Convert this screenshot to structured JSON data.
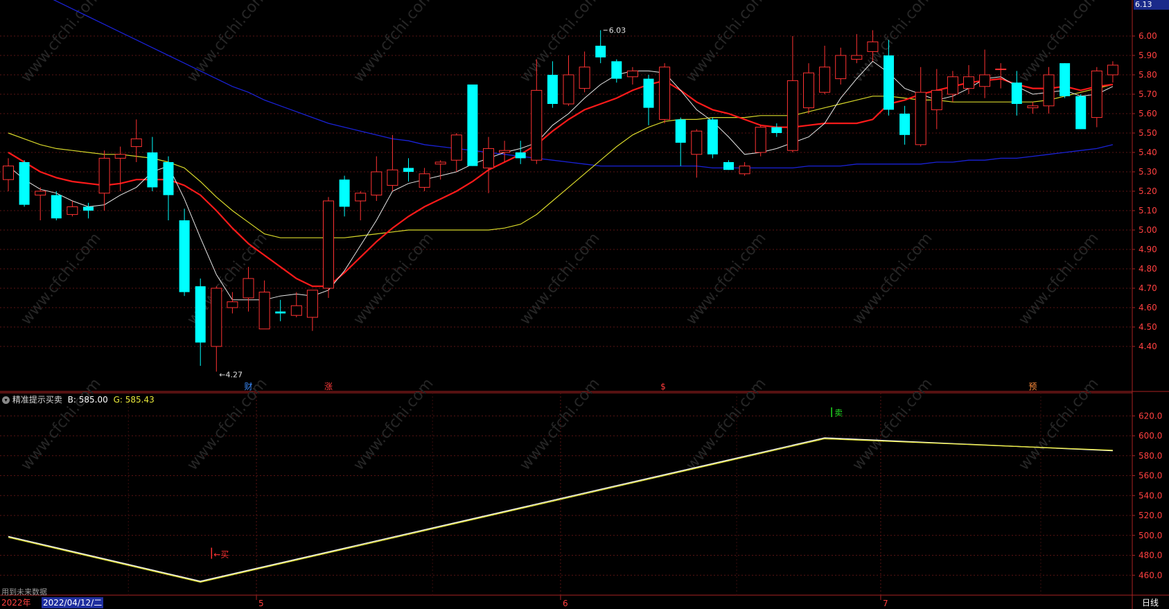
{
  "top_right_price": "6.13",
  "right_panel_label": "日线",
  "main": {
    "yticks": [
      "6.00",
      "5.90",
      "5.80",
      "5.70",
      "5.60",
      "5.50",
      "5.40",
      "5.30",
      "5.20",
      "5.10",
      "5.00",
      "4.90",
      "4.80",
      "4.70",
      "4.60",
      "4.50",
      "4.40"
    ],
    "high_label": "6.03",
    "low_label": "4.27",
    "markers": [
      {
        "text": "财",
        "color": "#3b8cff",
        "index": 15
      },
      {
        "text": "涨",
        "color": "#ff3b3b",
        "index": 20
      },
      {
        "text": "$",
        "color": "#ff3b3b",
        "index": 41
      },
      {
        "text": "预",
        "color": "#ff8c3b",
        "index": 64
      }
    ]
  },
  "indicator": {
    "name": "精准提示买卖",
    "b_text": "B: 585.00",
    "g_text": "G: 585.43",
    "yticks": [
      "620.0",
      "600.0",
      "580.0",
      "560.0",
      "540.0",
      "520.0",
      "500.0",
      "480.0",
      "460.0"
    ],
    "buy_label": "←买",
    "sell_label": "卖",
    "note": "用到未来数据"
  },
  "xaxis": {
    "year": "2022年",
    "cursor_date": "2022/04/12/二",
    "months": [
      {
        "label": "5",
        "index": 16
      },
      {
        "label": "6",
        "index": 35
      },
      {
        "label": "7",
        "index": 55
      }
    ]
  },
  "chart_data": [
    {
      "type": "candlestick",
      "ylim": [
        4.27,
        6.13
      ],
      "candles": [
        {
          "o": 5.26,
          "h": 5.37,
          "l": 5.2,
          "c": 5.33
        },
        {
          "o": 5.35,
          "h": 5.36,
          "l": 5.12,
          "c": 5.13
        },
        {
          "o": 5.18,
          "h": 5.22,
          "l": 5.05,
          "c": 5.2
        },
        {
          "o": 5.18,
          "h": 5.2,
          "l": 5.05,
          "c": 5.06
        },
        {
          "o": 5.08,
          "h": 5.15,
          "l": 5.07,
          "c": 5.12
        },
        {
          "o": 5.12,
          "h": 5.14,
          "l": 5.06,
          "c": 5.1
        },
        {
          "o": 5.19,
          "h": 5.41,
          "l": 5.1,
          "c": 5.37
        },
        {
          "o": 5.37,
          "h": 5.43,
          "l": 5.2,
          "c": 5.39
        },
        {
          "o": 5.43,
          "h": 5.57,
          "l": 5.35,
          "c": 5.47
        },
        {
          "o": 5.4,
          "h": 5.48,
          "l": 5.2,
          "c": 5.22
        },
        {
          "o": 5.35,
          "h": 5.38,
          "l": 5.05,
          "c": 5.18
        },
        {
          "o": 5.05,
          "h": 5.11,
          "l": 4.66,
          "c": 4.68
        },
        {
          "o": 4.71,
          "h": 4.75,
          "l": 4.3,
          "c": 4.42
        },
        {
          "o": 4.4,
          "h": 4.71,
          "l": 4.27,
          "c": 4.7
        },
        {
          "o": 4.6,
          "h": 4.68,
          "l": 4.57,
          "c": 4.63
        },
        {
          "o": 4.65,
          "h": 4.81,
          "l": 4.58,
          "c": 4.75
        },
        {
          "o": 4.49,
          "h": 4.74,
          "l": 4.49,
          "c": 4.68
        },
        {
          "o": 4.58,
          "h": 4.64,
          "l": 4.53,
          "c": 4.57
        },
        {
          "o": 4.56,
          "h": 4.68,
          "l": 4.55,
          "c": 4.61
        },
        {
          "o": 4.55,
          "h": 4.69,
          "l": 4.48,
          "c": 4.69
        },
        {
          "o": 4.7,
          "h": 5.17,
          "l": 4.65,
          "c": 5.15
        },
        {
          "o": 5.26,
          "h": 5.28,
          "l": 5.07,
          "c": 5.12
        },
        {
          "o": 5.15,
          "h": 5.2,
          "l": 5.05,
          "c": 5.19
        },
        {
          "o": 5.18,
          "h": 5.38,
          "l": 5.15,
          "c": 5.3
        },
        {
          "o": 5.23,
          "h": 5.49,
          "l": 5.2,
          "c": 5.31
        },
        {
          "o": 5.32,
          "h": 5.37,
          "l": 5.25,
          "c": 5.3
        },
        {
          "o": 5.22,
          "h": 5.32,
          "l": 5.2,
          "c": 5.29
        },
        {
          "o": 5.34,
          "h": 5.36,
          "l": 5.26,
          "c": 5.35
        },
        {
          "o": 5.36,
          "h": 5.5,
          "l": 5.3,
          "c": 5.49
        },
        {
          "o": 5.75,
          "h": 5.75,
          "l": 5.33,
          "c": 5.33
        },
        {
          "o": 5.32,
          "h": 5.48,
          "l": 5.19,
          "c": 5.42
        },
        {
          "o": 5.4,
          "h": 5.46,
          "l": 5.35,
          "c": 5.41
        },
        {
          "o": 5.4,
          "h": 5.46,
          "l": 5.34,
          "c": 5.37
        },
        {
          "o": 5.36,
          "h": 5.88,
          "l": 5.34,
          "c": 5.72
        },
        {
          "o": 5.8,
          "h": 5.87,
          "l": 5.63,
          "c": 5.65
        },
        {
          "o": 5.65,
          "h": 5.9,
          "l": 5.64,
          "c": 5.8
        },
        {
          "o": 5.73,
          "h": 5.92,
          "l": 5.71,
          "c": 5.84
        },
        {
          "o": 5.95,
          "h": 6.03,
          "l": 5.86,
          "c": 5.89
        },
        {
          "o": 5.87,
          "h": 5.88,
          "l": 5.76,
          "c": 5.78
        },
        {
          "o": 5.79,
          "h": 5.84,
          "l": 5.75,
          "c": 5.82
        },
        {
          "o": 5.78,
          "h": 5.8,
          "l": 5.54,
          "c": 5.63
        },
        {
          "o": 5.57,
          "h": 5.86,
          "l": 5.55,
          "c": 5.84
        },
        {
          "o": 5.57,
          "h": 5.58,
          "l": 5.33,
          "c": 5.45
        },
        {
          "o": 5.39,
          "h": 5.52,
          "l": 5.27,
          "c": 5.51
        },
        {
          "o": 5.57,
          "h": 5.58,
          "l": 5.37,
          "c": 5.39
        },
        {
          "o": 5.35,
          "h": 5.36,
          "l": 5.31,
          "c": 5.31
        },
        {
          "o": 5.29,
          "h": 5.35,
          "l": 5.28,
          "c": 5.33
        },
        {
          "o": 5.4,
          "h": 5.54,
          "l": 5.38,
          "c": 5.53
        },
        {
          "o": 5.53,
          "h": 5.55,
          "l": 5.48,
          "c": 5.5
        },
        {
          "o": 5.41,
          "h": 6.0,
          "l": 5.4,
          "c": 5.77
        },
        {
          "o": 5.63,
          "h": 5.86,
          "l": 5.6,
          "c": 5.81
        },
        {
          "o": 5.71,
          "h": 5.95,
          "l": 5.7,
          "c": 5.84
        },
        {
          "o": 5.78,
          "h": 5.94,
          "l": 5.75,
          "c": 5.9
        },
        {
          "o": 5.88,
          "h": 6.01,
          "l": 5.86,
          "c": 5.9
        },
        {
          "o": 5.92,
          "h": 6.03,
          "l": 5.87,
          "c": 5.97
        },
        {
          "o": 5.9,
          "h": 5.98,
          "l": 5.59,
          "c": 5.62
        },
        {
          "o": 5.6,
          "h": 5.64,
          "l": 5.44,
          "c": 5.49
        },
        {
          "o": 5.44,
          "h": 5.84,
          "l": 5.43,
          "c": 5.71
        },
        {
          "o": 5.62,
          "h": 5.83,
          "l": 5.52,
          "c": 5.72
        },
        {
          "o": 5.7,
          "h": 5.82,
          "l": 5.66,
          "c": 5.79
        },
        {
          "o": 5.73,
          "h": 5.85,
          "l": 5.7,
          "c": 5.79
        },
        {
          "o": 5.74,
          "h": 5.93,
          "l": 5.68,
          "c": 5.8
        },
        {
          "o": 5.83,
          "h": 5.86,
          "l": 5.73,
          "c": 5.83
        },
        {
          "o": 5.76,
          "h": 5.82,
          "l": 5.59,
          "c": 5.65
        },
        {
          "o": 5.63,
          "h": 5.66,
          "l": 5.6,
          "c": 5.64
        },
        {
          "o": 5.64,
          "h": 5.84,
          "l": 5.6,
          "c": 5.8
        },
        {
          "o": 5.86,
          "h": 5.86,
          "l": 5.68,
          "c": 5.69
        },
        {
          "o": 5.69,
          "h": 5.7,
          "l": 5.52,
          "c": 5.52
        },
        {
          "o": 5.58,
          "h": 5.84,
          "l": 5.53,
          "c": 5.82
        },
        {
          "o": 5.8,
          "h": 5.87,
          "l": 5.76,
          "c": 5.85
        }
      ],
      "ma_white": [
        5.33,
        5.26,
        5.21,
        5.19,
        5.15,
        5.12,
        5.13,
        5.18,
        5.22,
        5.3,
        5.33,
        5.16,
        4.96,
        4.77,
        4.64,
        4.64,
        4.64,
        4.66,
        4.67,
        4.66,
        4.69,
        4.79,
        4.92,
        5.05,
        5.2,
        5.24,
        5.26,
        5.28,
        5.3,
        5.34,
        5.37,
        5.4,
        5.42,
        5.45,
        5.54,
        5.6,
        5.68,
        5.75,
        5.8,
        5.82,
        5.82,
        5.81,
        5.72,
        5.62,
        5.56,
        5.48,
        5.39,
        5.4,
        5.42,
        5.45,
        5.48,
        5.55,
        5.68,
        5.78,
        5.87,
        5.81,
        5.73,
        5.7,
        5.67,
        5.69,
        5.73,
        5.78,
        5.79,
        5.74,
        5.7,
        5.71,
        5.72,
        5.69,
        5.7,
        5.74
      ],
      "ma_red": [
        5.4,
        5.35,
        5.3,
        5.27,
        5.25,
        5.24,
        5.23,
        5.24,
        5.26,
        5.26,
        5.26,
        5.23,
        5.18,
        5.1,
        5.01,
        4.93,
        4.87,
        4.81,
        4.75,
        4.71,
        4.71,
        4.78,
        4.86,
        4.94,
        5.01,
        5.07,
        5.12,
        5.16,
        5.2,
        5.25,
        5.31,
        5.35,
        5.39,
        5.44,
        5.51,
        5.57,
        5.62,
        5.65,
        5.68,
        5.72,
        5.75,
        5.77,
        5.72,
        5.66,
        5.62,
        5.6,
        5.57,
        5.54,
        5.53,
        5.53,
        5.54,
        5.55,
        5.55,
        5.55,
        5.57,
        5.65,
        5.67,
        5.7,
        5.72,
        5.74,
        5.76,
        5.77,
        5.78,
        5.75,
        5.73,
        5.73,
        5.74,
        5.72,
        5.74,
        5.75
      ],
      "ma_yellow": [
        5.5,
        5.47,
        5.44,
        5.42,
        5.41,
        5.4,
        5.39,
        5.39,
        5.38,
        5.37,
        5.35,
        5.32,
        5.25,
        5.17,
        5.1,
        5.04,
        4.98,
        4.96,
        4.96,
        4.96,
        4.96,
        4.96,
        4.97,
        4.98,
        4.99,
        5.0,
        5.0,
        5.0,
        5.0,
        5.0,
        5.0,
        5.01,
        5.03,
        5.08,
        5.15,
        5.22,
        5.29,
        5.36,
        5.43,
        5.49,
        5.53,
        5.56,
        5.57,
        5.57,
        5.58,
        5.58,
        5.58,
        5.59,
        5.59,
        5.59,
        5.61,
        5.63,
        5.65,
        5.67,
        5.69,
        5.69,
        5.68,
        5.67,
        5.67,
        5.66,
        5.66,
        5.66,
        5.66,
        5.66,
        5.66,
        5.67,
        5.69,
        5.71,
        5.73,
        5.75
      ],
      "ma_blue": [
        6.31,
        6.26,
        6.22,
        6.18,
        6.14,
        6.1,
        6.06,
        6.02,
        5.98,
        5.94,
        5.9,
        5.86,
        5.82,
        5.78,
        5.74,
        5.71,
        5.67,
        5.64,
        5.61,
        5.58,
        5.55,
        5.53,
        5.51,
        5.49,
        5.47,
        5.46,
        5.44,
        5.43,
        5.42,
        5.41,
        5.4,
        5.39,
        5.38,
        5.37,
        5.36,
        5.35,
        5.34,
        5.33,
        5.33,
        5.33,
        5.33,
        5.33,
        5.33,
        5.33,
        5.32,
        5.32,
        5.32,
        5.32,
        5.32,
        5.32,
        5.33,
        5.33,
        5.33,
        5.34,
        5.34,
        5.34,
        5.34,
        5.34,
        5.35,
        5.35,
        5.36,
        5.36,
        5.37,
        5.37,
        5.38,
        5.39,
        5.4,
        5.41,
        5.42,
        5.44
      ]
    },
    {
      "type": "line",
      "ylim": [
        452,
        632
      ],
      "series": [
        {
          "name": "B",
          "color": "#ffffff",
          "points": [
            [
              0,
              499
            ],
            [
              12,
              454
            ],
            [
              51,
              598
            ],
            [
              69,
              585
            ]
          ]
        },
        {
          "name": "G",
          "color": "#e8e83a",
          "points": [
            [
              0,
              498
            ],
            [
              12,
              453
            ],
            [
              51,
              597
            ],
            [
              69,
              585.43
            ]
          ]
        }
      ]
    }
  ]
}
